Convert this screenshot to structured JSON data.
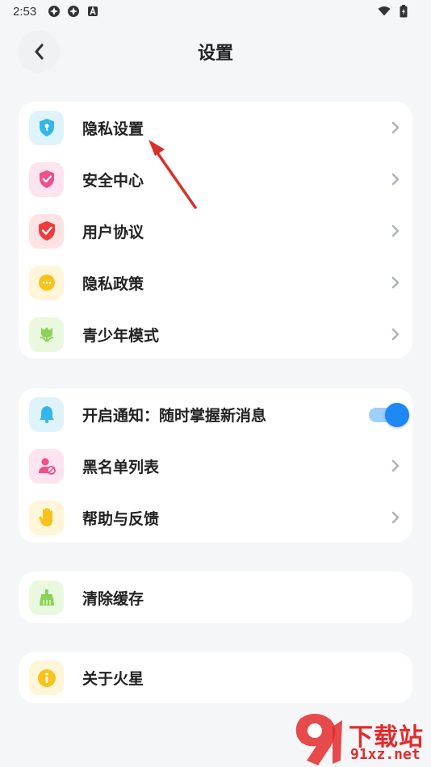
{
  "status_bar": {
    "time": "2:53"
  },
  "header": {
    "title": "设置"
  },
  "groups": [
    {
      "items": [
        {
          "label": "隐私设置",
          "icon": "shield-keyhole-icon",
          "icon_bg": "#dff3fb",
          "icon_color": "#33b7ea"
        },
        {
          "label": "安全中心",
          "icon": "shield-check-icon",
          "icon_bg": "#fde4ee",
          "icon_color": "#ef4f8a"
        },
        {
          "label": "用户协议",
          "icon": "shield-check-red-icon",
          "icon_bg": "#fde3e3",
          "icon_color": "#ef3b3b"
        },
        {
          "label": "隐私政策",
          "icon": "chat-bubble-icon",
          "icon_bg": "#fff6da",
          "icon_color": "#f7c21b"
        },
        {
          "label": "青少年模式",
          "icon": "tulip-icon",
          "icon_bg": "#eaf8e0",
          "icon_color": "#8ad25a"
        }
      ]
    },
    {
      "items": [
        {
          "label": "开启通知：随时掌握新消息",
          "icon": "bell-icon",
          "icon_bg": "#dff3fb",
          "icon_color": "#33b7ea",
          "toggle": true
        },
        {
          "label": "黑名单列表",
          "icon": "user-blocked-icon",
          "icon_bg": "#fde4ee",
          "icon_color": "#ef4f8a"
        },
        {
          "label": "帮助与反馈",
          "icon": "hand-icon",
          "icon_bg": "#fff6da",
          "icon_color": "#f7c21b"
        }
      ]
    },
    {
      "items": [
        {
          "label": "清除缓存",
          "icon": "broom-icon",
          "icon_bg": "#eaf8e0",
          "icon_color": "#8ad25a"
        }
      ]
    },
    {
      "items": [
        {
          "label": "关于火星",
          "icon": "info-icon",
          "icon_bg": "#fff6da",
          "icon_color": "#f7c21b"
        }
      ]
    }
  ],
  "notifications_enabled": true,
  "watermark": {
    "line1": "下载站",
    "line2": "91xz.net"
  }
}
